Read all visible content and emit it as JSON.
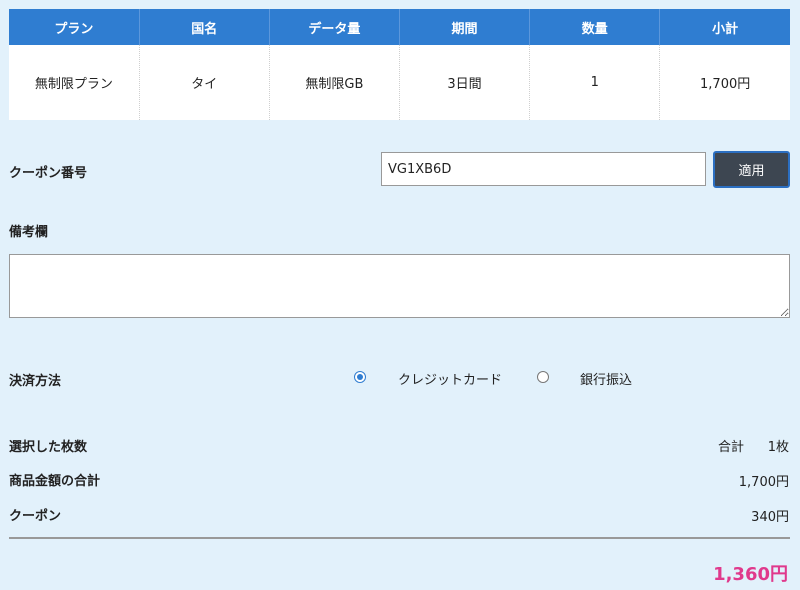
{
  "order_table": {
    "headers": [
      "プラン",
      "国名",
      "データ量",
      "期間",
      "数量",
      "小計"
    ],
    "row": [
      "無制限プラン",
      "タイ",
      "無制限GB",
      "3日間",
      "1",
      "1,700円"
    ]
  },
  "coupon": {
    "label": "クーポン番号",
    "value": "VG1XB6D",
    "apply_label": "適用"
  },
  "remarks": {
    "label": "備考欄",
    "value": ""
  },
  "payment": {
    "label": "決済方法",
    "options": [
      "クレジットカード",
      "銀行振込"
    ],
    "selected": "クレジットカード"
  },
  "summary": {
    "count_label": "選択した枚数",
    "count_prefix": "合計",
    "count_value": "1枚",
    "subtotal_label": "商品金額の合計",
    "subtotal_value": "1,700円",
    "coupon_label": "クーポン",
    "coupon_value": "340円",
    "total_value": "1,360円"
  },
  "colors": {
    "header_bg": "#2f7dd1",
    "page_bg": "#e2f1fb",
    "total_text": "#e0398c",
    "button_bg": "#3d4651"
  }
}
